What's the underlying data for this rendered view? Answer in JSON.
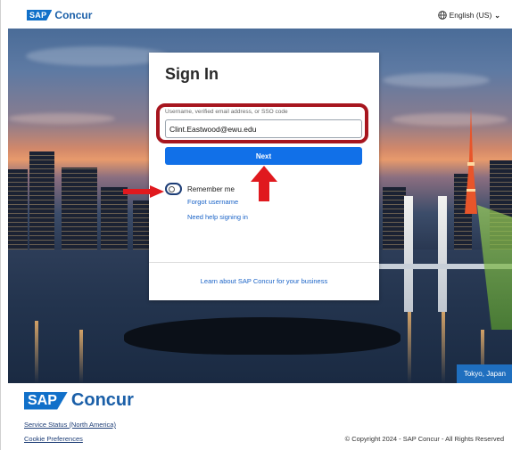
{
  "header": {
    "brand_badge": "SAP",
    "brand_name": "Concur",
    "language": "English (US)",
    "icons": [
      "globe-icon",
      "chevron-down-icon"
    ]
  },
  "hero": {
    "location_label": "Tokyo, Japan"
  },
  "signin": {
    "title": "Sign In",
    "username_label": "Username, verified email address, or SSO code",
    "username_value": "Clint.Eastwood@ewu.edu",
    "next_label": "Next",
    "remember_label": "Remember me",
    "remember_checked": false,
    "forgot_username": "Forgot username",
    "need_help": "Need help signing in",
    "learn_more": "Learn about SAP Concur for your business"
  },
  "annotations": {
    "highlight_color": "#a7161f",
    "arrow_color": "#e0191e"
  },
  "footer": {
    "brand_badge": "SAP",
    "brand_name": "Concur",
    "service_status": "Service Status (North America)",
    "cookie_preferences": "Cookie Preferences",
    "copyright": "© Copyright 2024 - SAP Concur - All Rights Reserved"
  },
  "colors": {
    "brand_blue": "#1170c9",
    "button_blue": "#1170e8",
    "link_blue": "#1a63c7"
  }
}
